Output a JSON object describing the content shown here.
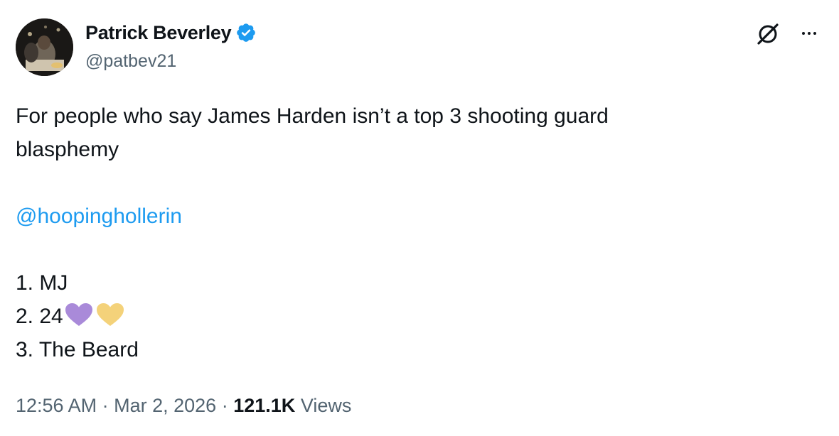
{
  "author": {
    "display_name": "Patrick Beverley",
    "handle": "@patbev21",
    "verified": true
  },
  "tweet": {
    "line1": "For people who say James Harden isn’t a top 3 shooting guard",
    "line2": "blasphemy",
    "mention": "@hoopinghollerin",
    "list": [
      "1. MJ",
      "2. 24",
      "3. The Beard"
    ],
    "emoji": [
      "purple-heart",
      "yellow-heart"
    ]
  },
  "meta": {
    "time": "12:56 AM",
    "separator": "·",
    "date": "Mar 2, 2026",
    "views_count": "121.1K",
    "views_label": "Views"
  },
  "icons": {
    "grok": "grok-icon",
    "more": "more-options-icon",
    "verified": "verified-badge-icon"
  },
  "colors": {
    "link": "#1d9bf0",
    "secondary_text": "#536471",
    "verified_badge": "#1d9bf0",
    "purple_heart": "#a98ad9",
    "yellow_heart": "#f4d27a"
  }
}
